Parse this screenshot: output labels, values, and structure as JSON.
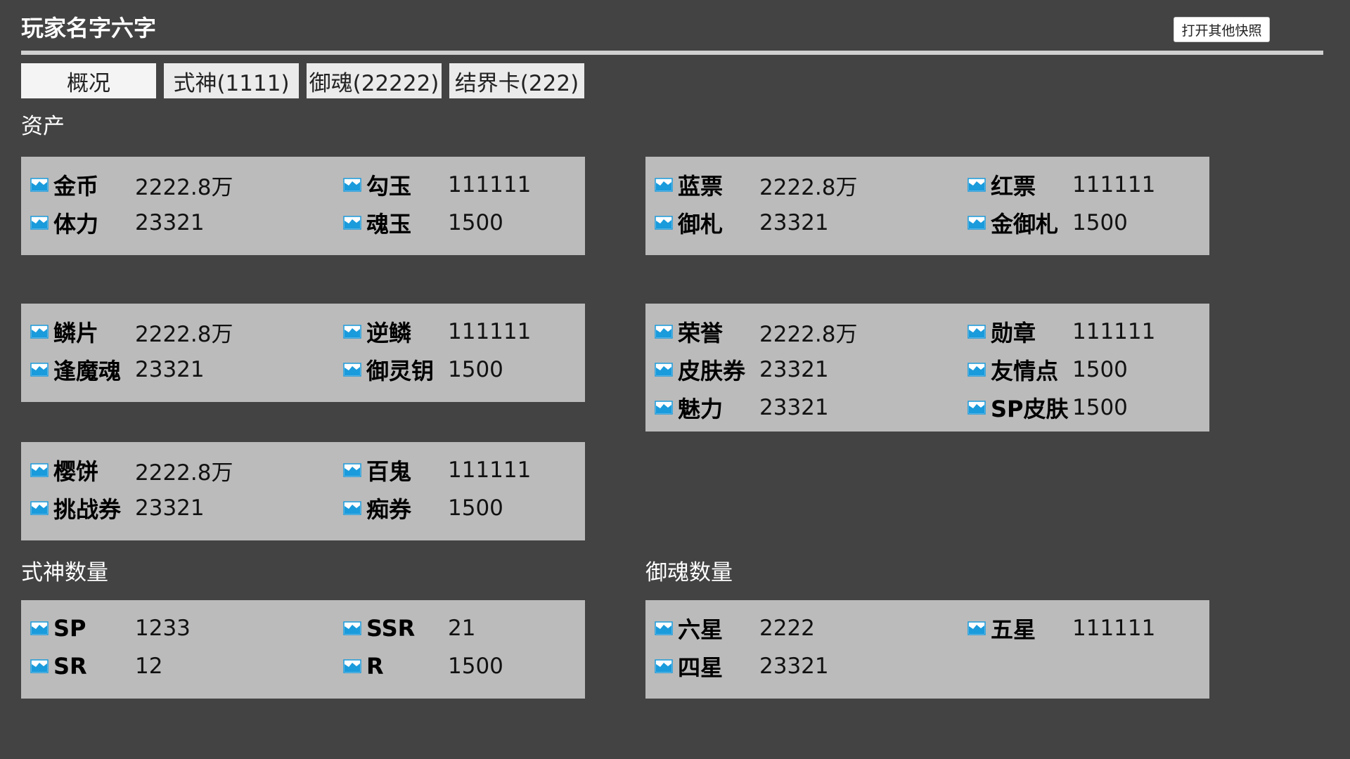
{
  "header": {
    "player_name": "玩家名字六字",
    "snapshot_button": "打开其他快照"
  },
  "tabs": [
    {
      "label": "概况"
    },
    {
      "label": "式神(1111)"
    },
    {
      "label": "御魂(22222)"
    },
    {
      "label": "结界卡(222)"
    }
  ],
  "sections": {
    "assets": "资产",
    "shikigami_count": "式神数量",
    "mitama_count": "御魂数量"
  },
  "panels": {
    "assets_1": [
      {
        "label": "金币",
        "value": "2222.8万"
      },
      {
        "label": "勾玉",
        "value": "111111"
      },
      {
        "label": "体力",
        "value": "23321"
      },
      {
        "label": "魂玉",
        "value": "1500"
      }
    ],
    "assets_2": [
      {
        "label": "蓝票",
        "value": "2222.8万"
      },
      {
        "label": "红票",
        "value": "111111"
      },
      {
        "label": "御札",
        "value": "23321"
      },
      {
        "label": "金御札",
        "value": "1500"
      }
    ],
    "assets_3": [
      {
        "label": "鳞片",
        "value": "2222.8万"
      },
      {
        "label": "逆鳞",
        "value": "111111"
      },
      {
        "label": "逢魔魂",
        "value": "23321"
      },
      {
        "label": "御灵钥",
        "value": "1500"
      }
    ],
    "assets_4": [
      {
        "label": "荣誉",
        "value": "2222.8万"
      },
      {
        "label": "勋章",
        "value": "111111"
      },
      {
        "label": "皮肤券",
        "value": "23321"
      },
      {
        "label": "友情点",
        "value": "1500"
      },
      {
        "label": "魅力",
        "value": "23321"
      },
      {
        "label": "SP皮肤",
        "value": "1500"
      }
    ],
    "assets_5": [
      {
        "label": "樱饼",
        "value": "2222.8万"
      },
      {
        "label": "百鬼",
        "value": "111111"
      },
      {
        "label": "挑战券",
        "value": "23321"
      },
      {
        "label": "痴券",
        "value": "1500"
      }
    ],
    "shikigami": [
      {
        "label": "SP",
        "value": "1233"
      },
      {
        "label": "SSR",
        "value": "21"
      },
      {
        "label": "SR",
        "value": "12"
      },
      {
        "label": "R",
        "value": "1500"
      }
    ],
    "mitama": [
      {
        "label": "六星",
        "value": "2222"
      },
      {
        "label": "五星",
        "value": "111111"
      },
      {
        "label": "四星",
        "value": "23321"
      }
    ]
  },
  "colors": {
    "background": "#434343",
    "panel": "#bbbbbb",
    "icon_blue": "#1a9bdc"
  },
  "icon": "image-icon"
}
